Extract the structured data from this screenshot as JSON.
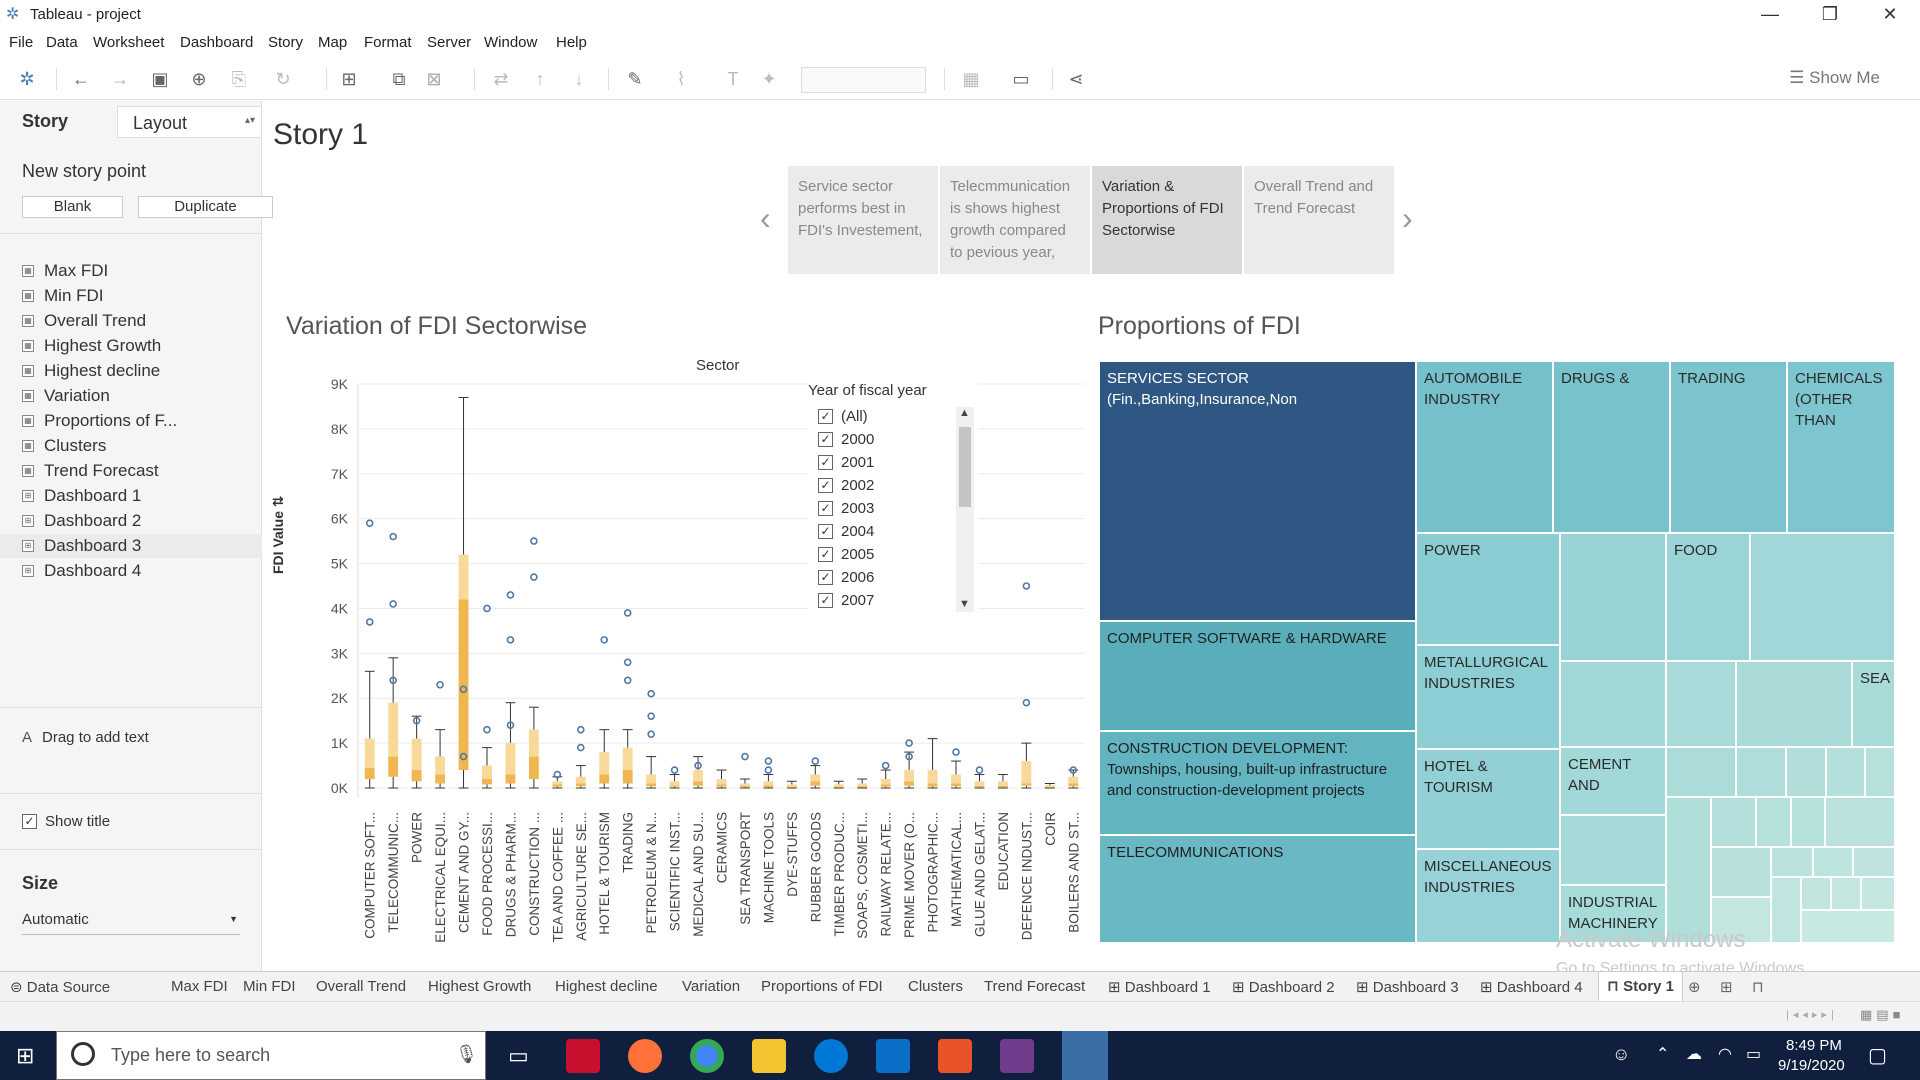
{
  "window": {
    "title": "Tableau - project",
    "minimize": "—",
    "restore": "❐",
    "close": "✕"
  },
  "menu": [
    "File",
    "Data",
    "Worksheet",
    "Dashboard",
    "Story",
    "Map",
    "Format",
    "Server",
    "Window",
    "Help"
  ],
  "toolbar": {
    "show_me": "Show Me"
  },
  "left_panel": {
    "tab_story": "Story",
    "tab_layout": "Layout",
    "new_story_point": "New story point",
    "blank_button": "Blank",
    "duplicate_button": "Duplicate",
    "sheets": [
      {
        "label": "Max FDI",
        "kind": "sheet"
      },
      {
        "label": "Min FDI",
        "kind": "sheet"
      },
      {
        "label": "Overall Trend",
        "kind": "sheet"
      },
      {
        "label": "Highest Growth",
        "kind": "sheet"
      },
      {
        "label": "Highest decline",
        "kind": "sheet"
      },
      {
        "label": "Variation",
        "kind": "sheet"
      },
      {
        "label": "Proportions of F...",
        "kind": "sheet"
      },
      {
        "label": "Clusters",
        "kind": "sheet"
      },
      {
        "label": "Trend Forecast",
        "kind": "sheet"
      },
      {
        "label": "Dashboard 1",
        "kind": "dashboard"
      },
      {
        "label": "Dashboard 2",
        "kind": "dashboard"
      },
      {
        "label": "Dashboard 3",
        "kind": "dashboard"
      },
      {
        "label": "Dashboard 4",
        "kind": "dashboard"
      }
    ],
    "drag_text": "Drag to add text",
    "show_title": "Show title",
    "size_label": "Size",
    "size_value": "Automatic"
  },
  "story": {
    "title": "Story 1",
    "points": [
      {
        "text": "Service sector performs best in FDI's Investement,",
        "active": false
      },
      {
        "text": "Telecmmunication is shows highest growth compared to pevious year,",
        "active": false
      },
      {
        "text": "Variation & Proportions of FDI Sectorwise",
        "active": true
      },
      {
        "text": "Overall Trend and Trend Forecast",
        "active": false
      }
    ]
  },
  "variation": {
    "title": "Variation of FDI Sectorwise",
    "header": "Sector",
    "ylabel": "FDI Value",
    "filter": {
      "title": "Year of fiscal year",
      "items": [
        "(All)",
        "2000",
        "2001",
        "2002",
        "2003",
        "2004",
        "2005",
        "2006",
        "2007"
      ]
    }
  },
  "chart_data": {
    "type": "box",
    "title": "Variation of FDI Sectorwise",
    "xlabel": "Sector",
    "ylabel": "FDI Value",
    "ylim": [
      0,
      9000
    ],
    "yticks": [
      "0K",
      "1K",
      "2K",
      "3K",
      "4K",
      "5K",
      "6K",
      "7K",
      "8K",
      "9K"
    ],
    "categories": [
      "COMPUTER SOFT...",
      "TELECOMMUNIC...",
      "POWER",
      "ELECTRICAL EQUI...",
      "CEMENT AND GY...",
      "FOOD PROCESSI...",
      "DRUGS & PHARM...",
      "CONSTRUCTION ...",
      "TEA AND COFFEE ...",
      "AGRICULTURE SE...",
      "HOTEL & TOURISM",
      "TRADING",
      "PETROLEUM & N...",
      "SCIENTIFIC INST...",
      "MEDICAL AND SU...",
      "CERAMICS",
      "SEA TRANSPORT",
      "MACHINE TOOLS",
      "DYE-STUFFS",
      "RUBBER GOODS",
      "TIMBER PRODUC...",
      "SOAPS, COSMETI...",
      "RAILWAY RELATE...",
      "PRIME MOVER (O...",
      "PHOTOGRAPHIC...",
      "MATHEMATICAL...",
      "GLUE AND GELAT...",
      "EDUCATION",
      "DEFENCE INDUST...",
      "COIR",
      "BOILERS AND ST..."
    ],
    "boxes": [
      {
        "min": 0,
        "q1": 200,
        "median": 450,
        "q3": 1100,
        "max": 2600,
        "outliers": [
          5900,
          3700
        ]
      },
      {
        "min": 0,
        "q1": 250,
        "median": 700,
        "q3": 1900,
        "max": 2900,
        "outliers": [
          5600,
          4100,
          2400
        ]
      },
      {
        "min": 0,
        "q1": 150,
        "median": 400,
        "q3": 1100,
        "max": 1600,
        "outliers": [
          1500
        ]
      },
      {
        "min": 0,
        "q1": 100,
        "median": 300,
        "q3": 700,
        "max": 1300,
        "outliers": [
          2300
        ]
      },
      {
        "min": 0,
        "q1": 400,
        "median": 4200,
        "q3": 5200,
        "max": 8700,
        "outliers": [
          2200,
          700
        ]
      },
      {
        "min": 0,
        "q1": 80,
        "median": 200,
        "q3": 500,
        "max": 900,
        "outliers": [
          4000,
          1300
        ]
      },
      {
        "min": 0,
        "q1": 100,
        "median": 300,
        "q3": 1000,
        "max": 1900,
        "outliers": [
          4300,
          3300,
          1400
        ]
      },
      {
        "min": 0,
        "q1": 200,
        "median": 700,
        "q3": 1300,
        "max": 1800,
        "outliers": [
          5500,
          4700
        ]
      },
      {
        "min": 0,
        "q1": 30,
        "median": 80,
        "q3": 150,
        "max": 250,
        "outliers": [
          300
        ]
      },
      {
        "min": 0,
        "q1": 40,
        "median": 100,
        "q3": 250,
        "max": 500,
        "outliers": [
          1300,
          900
        ]
      },
      {
        "min": 0,
        "q1": 100,
        "median": 300,
        "q3": 800,
        "max": 1300,
        "outliers": [
          3300
        ]
      },
      {
        "min": 0,
        "q1": 100,
        "median": 400,
        "q3": 900,
        "max": 1300,
        "outliers": [
          3900,
          2800,
          2400
        ]
      },
      {
        "min": 0,
        "q1": 40,
        "median": 100,
        "q3": 300,
        "max": 700,
        "outliers": [
          2100,
          1600,
          1200
        ]
      },
      {
        "min": 0,
        "q1": 30,
        "median": 60,
        "q3": 150,
        "max": 300,
        "outliers": [
          400
        ]
      },
      {
        "min": 0,
        "q1": 50,
        "median": 150,
        "q3": 400,
        "max": 700,
        "outliers": [
          500
        ]
      },
      {
        "min": 0,
        "q1": 30,
        "median": 80,
        "q3": 200,
        "max": 400,
        "outliers": []
      },
      {
        "min": 0,
        "q1": 20,
        "median": 50,
        "q3": 100,
        "max": 200,
        "outliers": [
          700
        ]
      },
      {
        "min": 0,
        "q1": 20,
        "median": 60,
        "q3": 150,
        "max": 300,
        "outliers": [
          600,
          400
        ]
      },
      {
        "min": 0,
        "q1": 10,
        "median": 30,
        "q3": 80,
        "max": 150,
        "outliers": []
      },
      {
        "min": 0,
        "q1": 50,
        "median": 150,
        "q3": 300,
        "max": 500,
        "outliers": [
          600
        ]
      },
      {
        "min": 0,
        "q1": 10,
        "median": 30,
        "q3": 80,
        "max": 150,
        "outliers": []
      },
      {
        "min": 0,
        "q1": 10,
        "median": 40,
        "q3": 100,
        "max": 200,
        "outliers": []
      },
      {
        "min": 0,
        "q1": 30,
        "median": 80,
        "q3": 200,
        "max": 400,
        "outliers": [
          500
        ]
      },
      {
        "min": 0,
        "q1": 50,
        "median": 150,
        "q3": 400,
        "max": 800,
        "outliers": [
          1000,
          700
        ]
      },
      {
        "min": 0,
        "q1": 30,
        "median": 100,
        "q3": 400,
        "max": 1100,
        "outliers": []
      },
      {
        "min": 0,
        "q1": 40,
        "median": 100,
        "q3": 300,
        "max": 600,
        "outliers": [
          800
        ]
      },
      {
        "min": 0,
        "q1": 20,
        "median": 50,
        "q3": 150,
        "max": 300,
        "outliers": [
          400
        ]
      },
      {
        "min": 0,
        "q1": 20,
        "median": 50,
        "q3": 150,
        "max": 300,
        "outliers": []
      },
      {
        "min": 0,
        "q1": 50,
        "median": 100,
        "q3": 600,
        "max": 1000,
        "outliers": [
          4500,
          1900
        ]
      },
      {
        "min": 0,
        "q1": 10,
        "median": 30,
        "q3": 60,
        "max": 100,
        "outliers": []
      },
      {
        "min": 0,
        "q1": 40,
        "median": 100,
        "q3": 250,
        "max": 400,
        "outliers": [
          400
        ]
      }
    ],
    "box_color": "#f3c56a",
    "outlier_color": "#4e79a7"
  },
  "proportions": {
    "title": "Proportions of FDI",
    "cells": [
      {
        "label": "SERVICES SECTOR\n(Fin.,Banking,Insurance,Non",
        "color": "#2e5883",
        "text": "#ffffff"
      },
      {
        "label": "AUTOMOBILE INDUSTRY",
        "color": "#75c0cb",
        "text": "#2a2a2a"
      },
      {
        "label": "DRUGS &",
        "color": "#78c2cc",
        "text": "#2a2a2a"
      },
      {
        "label": "TRADING",
        "color": "#7bc4cd",
        "text": "#2a2a2a"
      },
      {
        "label": "CHEMICALS (OTHER THAN",
        "color": "#7ec6cf",
        "text": "#2a2a2a"
      },
      {
        "label": "COMPUTER SOFTWARE & HARDWARE",
        "color": "#5aaebb",
        "text": "#1f1f1f"
      },
      {
        "label": "POWER",
        "color": "#8bcdd3",
        "text": "#2a2a2a"
      },
      {
        "label": "FOOD",
        "color": "#9ad4d6",
        "text": "#2a2a2a"
      },
      {
        "label": "METALLURGICAL INDUSTRIES",
        "color": "#8dced4",
        "text": "#2a2a2a"
      },
      {
        "label": "SEA",
        "color": "#a9dcd9",
        "text": "#2a2a2a"
      },
      {
        "label": "CONSTRUCTION DEVELOPMENT: Townships, housing, built-up infrastructure and construction-development projects",
        "color": "#62b4c0",
        "text": "#1f1f1f"
      },
      {
        "label": "HOTEL & TOURISM",
        "color": "#92d0d6",
        "text": "#2a2a2a"
      },
      {
        "label": "CEMENT AND",
        "color": "#a2d8d8",
        "text": "#2a2a2a"
      },
      {
        "label": "TELECOMMUNICATIONS",
        "color": "#6ab8c3",
        "text": "#1f1f1f"
      },
      {
        "label": "MISCELLANEOUS INDUSTRIES",
        "color": "#96d2d7",
        "text": "#2a2a2a"
      },
      {
        "label": "INDUSTRIAL MACHINERY",
        "color": "#a7dbd9",
        "text": "#2a2a2a"
      }
    ]
  },
  "watermark": {
    "line1": "Activate Windows",
    "line2": "Go to Settings to activate Windows."
  },
  "sheet_tabs": [
    "Data Source",
    "Max FDI",
    "Min FDI",
    "Overall Trend",
    "Highest Growth",
    "Highest decline",
    "Variation",
    "Proportions of FDI",
    "Clusters",
    "Trend Forecast",
    "Dashboard 1",
    "Dashboard 2",
    "Dashboard 3",
    "Dashboard 4",
    "Story 1"
  ],
  "taskbar": {
    "search_placeholder": "Type here to search",
    "time": "8:49 PM",
    "date": "9/19/2020"
  }
}
